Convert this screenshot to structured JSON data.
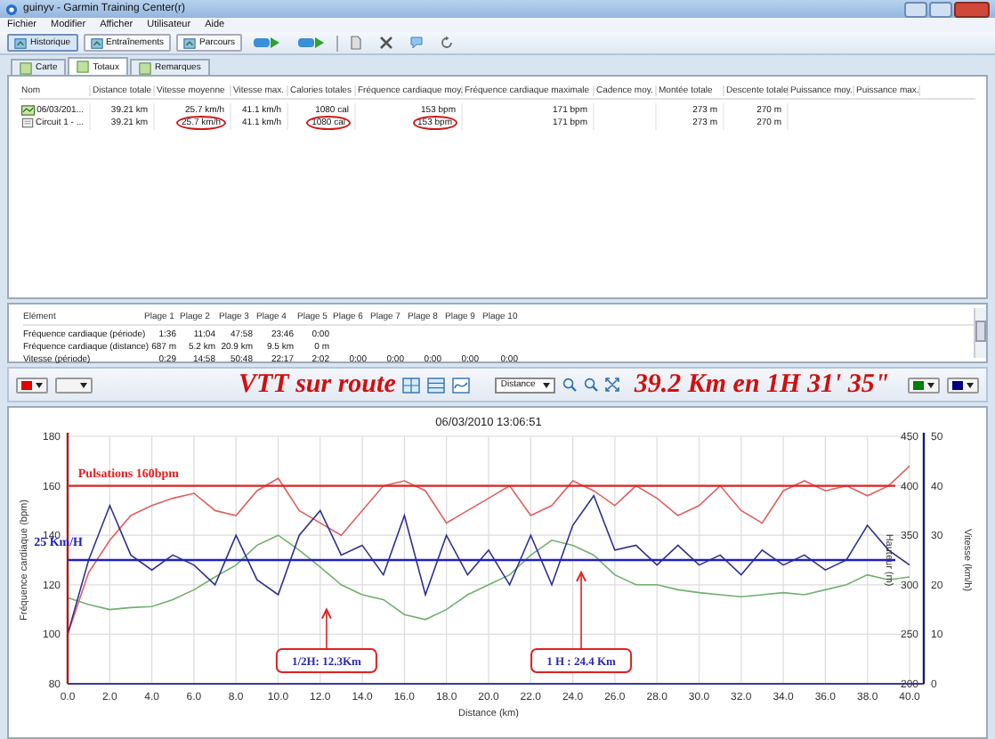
{
  "window": {
    "title": "guinyv - Garmin Training Center(r)"
  },
  "menu": [
    "Fichier",
    "Modifier",
    "Afficher",
    "Utilisateur",
    "Aide"
  ],
  "toolbar": [
    {
      "label": "Historique",
      "selected": true
    },
    {
      "label": "Entraînements",
      "selected": false
    },
    {
      "label": "Parcours",
      "selected": false
    }
  ],
  "tabs": [
    {
      "label": "Carte",
      "selected": false
    },
    {
      "label": "Totaux",
      "selected": true
    },
    {
      "label": "Remarques",
      "selected": false
    }
  ],
  "totals": {
    "columns": [
      "Nom",
      "Distance totale",
      "Vitesse moyenne",
      "Vitesse max.",
      "Calories totales",
      "Fréquence cardiaque moy.",
      "Fréquence cardiaque maximale",
      "Cadence moy.",
      "Montée totale",
      "Descente totale",
      "Puissance moy.",
      "Puissance max."
    ],
    "rows": [
      {
        "kind": "activity",
        "cells": [
          {
            "text": "06/03/201...",
            "circled": false
          },
          {
            "text": "39.21 km",
            "circled": false
          },
          {
            "text": "25.7 km/h",
            "circled": false
          },
          {
            "text": "41.1 km/h",
            "circled": false
          },
          {
            "text": "1080 cal",
            "circled": false
          },
          {
            "text": "153 bpm",
            "circled": false
          },
          {
            "text": "171 bpm",
            "circled": false
          },
          {},
          {
            "text": "273 m",
            "circled": false
          },
          {
            "text": "270 m",
            "circled": false
          }
        ]
      },
      {
        "kind": "lap",
        "cells": [
          {
            "text": "Circuit 1 - ...",
            "circled": false
          },
          {
            "text": "39.21 km",
            "circled": false
          },
          {
            "text": "25.7 km/h",
            "circled": true
          },
          {
            "text": "41.1 km/h",
            "circled": false
          },
          {
            "text": "1080 cal",
            "circled": true
          },
          {
            "text": "153 bpm",
            "circled": true
          },
          {
            "text": "171 bpm",
            "circled": false
          },
          {},
          {
            "text": "273 m",
            "circled": false
          },
          {
            "text": "270 m",
            "circled": false
          }
        ]
      }
    ]
  },
  "zones": {
    "columns": [
      "Elément",
      "Plage 1",
      "Plage 2",
      "Plage 3",
      "Plage 4",
      "Plage 5",
      "Plage 6",
      "Plage 7",
      "Plage 8",
      "Plage 9",
      "Plage 10"
    ],
    "rows": [
      [
        "Fréquence cardiaque (période)",
        "1:36",
        "11:04",
        "47:58",
        "23:46",
        "0:00"
      ],
      [
        "Fréquence cardiaque (distance)",
        "687 m",
        "5.2 km",
        "20.9 km",
        "9.5 km",
        "0 m"
      ],
      [
        "Vitesse (période)",
        "0:29",
        "14:58",
        "50:48",
        "22:17",
        "2:02",
        "0:00",
        "0:00",
        "0:00",
        "0:00",
        "0:00"
      ]
    ]
  },
  "chart_toolbar": {
    "left_pickers": [
      {
        "kind": "swatch",
        "color": "#e00000"
      },
      {
        "kind": "blank"
      }
    ],
    "title": "VTT sur route",
    "x_axis_select": "Distance",
    "summary": "39.2 Km en 1H 31' 35\"",
    "right_pickers": [
      {
        "kind": "swatch",
        "color": "#008000"
      },
      {
        "kind": "swatch",
        "color": "#000080"
      }
    ]
  },
  "chart": {
    "chart_data": {
      "type": "line",
      "title": "06/03/2010 13:06:51",
      "xlabel": "Distance (km)",
      "xlim": [
        0,
        40
      ],
      "xticks": [
        {
          "value": 0,
          "label": "0.0"
        },
        {
          "value": 2,
          "label": "2.0"
        },
        {
          "value": 4,
          "label": "4.0"
        },
        {
          "value": 6,
          "label": "6.0"
        },
        {
          "value": 8,
          "label": "8.0"
        },
        {
          "value": 10,
          "label": "10.0"
        },
        {
          "value": 12,
          "label": "12.0"
        },
        {
          "value": 14,
          "label": "14.0"
        },
        {
          "value": 16,
          "label": "16.0"
        },
        {
          "value": 18,
          "label": "18.0"
        },
        {
          "value": 20,
          "label": "20.0"
        },
        {
          "value": 22,
          "label": "22.0"
        },
        {
          "value": 24,
          "label": "24.0"
        },
        {
          "value": 26,
          "label": "26.0"
        },
        {
          "value": 28,
          "label": "28.0"
        },
        {
          "value": 30,
          "label": "30.0"
        },
        {
          "value": 32,
          "label": "32.0"
        },
        {
          "value": 34,
          "label": "34.0"
        },
        {
          "value": 36,
          "label": "36.0"
        },
        {
          "value": 38,
          "label": "38.0"
        },
        {
          "value": 40,
          "label": "40.0"
        }
      ],
      "ylabel": "Fréquence cardiaque (bpm)",
      "ylim": [
        80,
        180
      ],
      "yticks": [
        80,
        100,
        120,
        140,
        160,
        180
      ],
      "y2label": "Hauteur (m)",
      "y2lim": [
        200,
        450
      ],
      "y2ticks": [
        200,
        250,
        300,
        350,
        400,
        450
      ],
      "y3label": "Vitesse (km/h)",
      "y3lim": [
        0,
        50
      ],
      "y3ticks": [
        0,
        10,
        20,
        30,
        40,
        50
      ],
      "x": [
        0,
        1,
        2,
        3,
        4,
        5,
        6,
        7,
        8,
        9,
        10,
        11,
        12,
        13,
        14,
        15,
        16,
        17,
        18,
        19,
        20,
        21,
        22,
        23,
        24,
        25,
        26,
        27,
        28,
        29,
        30,
        31,
        32,
        33,
        34,
        35,
        36,
        37,
        38,
        39,
        40
      ],
      "series": [
        {
          "color": "#e06060",
          "values": [
            100,
            125,
            138,
            148,
            152,
            155,
            157,
            150,
            148,
            158,
            163,
            150,
            145,
            140,
            150,
            160,
            162,
            158,
            145,
            150,
            155,
            160,
            148,
            152,
            162,
            158,
            152,
            160,
            155,
            148,
            152,
            160,
            150,
            145,
            158,
            162,
            158,
            160,
            156,
            160,
            168
          ]
        },
        {
          "color": "#70b070",
          "axis": "y2",
          "values": [
            287,
            280,
            275,
            277,
            278,
            285,
            295,
            308,
            320,
            340,
            350,
            335,
            318,
            300,
            290,
            285,
            270,
            265,
            275,
            290,
            300,
            310,
            330,
            345,
            340,
            330,
            310,
            300,
            300,
            295,
            292,
            290,
            288,
            290,
            292,
            290,
            295,
            300,
            310,
            305,
            308
          ]
        },
        {
          "color": "#303090",
          "axis": "y3",
          "values": [
            10,
            25,
            36,
            26,
            23,
            26,
            24,
            20,
            30,
            21,
            18,
            30,
            35,
            26,
            28,
            22,
            34,
            18,
            30,
            22,
            27,
            20,
            30,
            20,
            32,
            38,
            27,
            28,
            24,
            28,
            24,
            26,
            22,
            27,
            24,
            26,
            23,
            25,
            32,
            27,
            24
          ]
        }
      ],
      "grid": true,
      "ref_lines": [
        {
          "value": 160,
          "axis": "y",
          "label": "Pulsations 160bpm",
          "color": "#e02020"
        },
        {
          "value": 25,
          "axis": "y3",
          "label": "25 Km/H",
          "color": "#2020c0"
        }
      ],
      "annotations": [
        "1/2H: 12.3Km",
        "1 H : 24.4 Km"
      ]
    }
  }
}
